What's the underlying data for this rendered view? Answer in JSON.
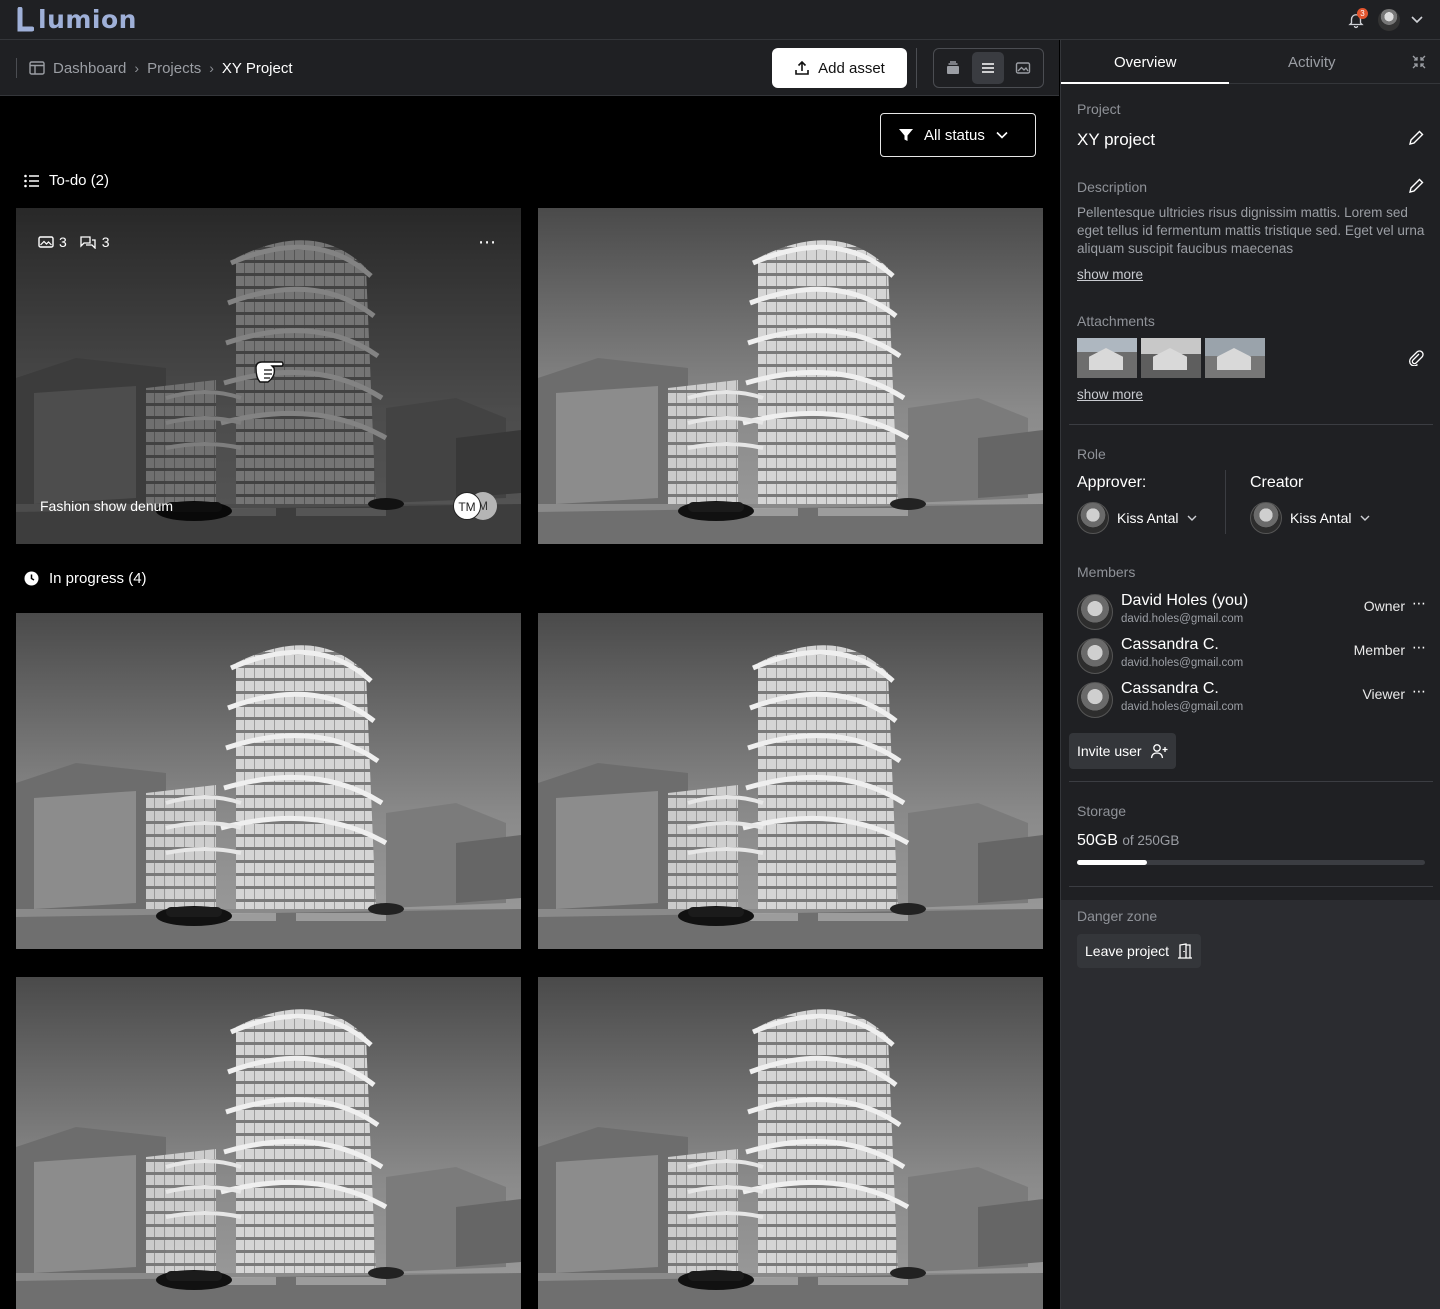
{
  "app": {
    "logo_text": "lumion",
    "notifications": "3"
  },
  "breadcrumb": {
    "items": [
      "Dashboard",
      "Projects",
      "XY Project"
    ]
  },
  "toolbar": {
    "add_asset": "Add asset"
  },
  "filter": {
    "label": "All status"
  },
  "sections": {
    "todo": {
      "label": "To-do (2)"
    },
    "in_progress": {
      "label": "In progress (4)"
    }
  },
  "card1": {
    "images": "3",
    "comments": "3",
    "title": "Fashion show denum",
    "avatar_a": "TM",
    "avatar_b": "M"
  },
  "panel": {
    "tabs": [
      "Overview",
      "Activity"
    ],
    "project_label": "Project",
    "project_name": "XY project",
    "description_label": "Description",
    "description": "Pellentesque ultricies risus dignissim mattis. Lorem sed eget tellus id fermentum mattis tristique sed. Eget vel urna aliquam suscipit faucibus maecenas",
    "show_more": "show more",
    "attachments_label": "Attachments",
    "role_label": "Role",
    "approver_label": "Approver:",
    "approver_name": "Kiss Antal",
    "creator_label": "Creator",
    "creator_name": "Kiss Antal",
    "members_label": "Members",
    "members": [
      {
        "name": "David Holes (you)",
        "email": "david.holes@gmail.com",
        "role": "Owner"
      },
      {
        "name": "Cassandra C.",
        "email": "david.holes@gmail.com",
        "role": "Member"
      },
      {
        "name": "Cassandra C.",
        "email": "david.holes@gmail.com",
        "role": "Viewer"
      }
    ],
    "invite_label": "Invite user",
    "storage_label": "Storage",
    "storage_used": "50GB",
    "storage_total": "of 250GB",
    "storage_fraction": 0.2,
    "danger_label": "Danger zone",
    "leave_label": "Leave project"
  }
}
